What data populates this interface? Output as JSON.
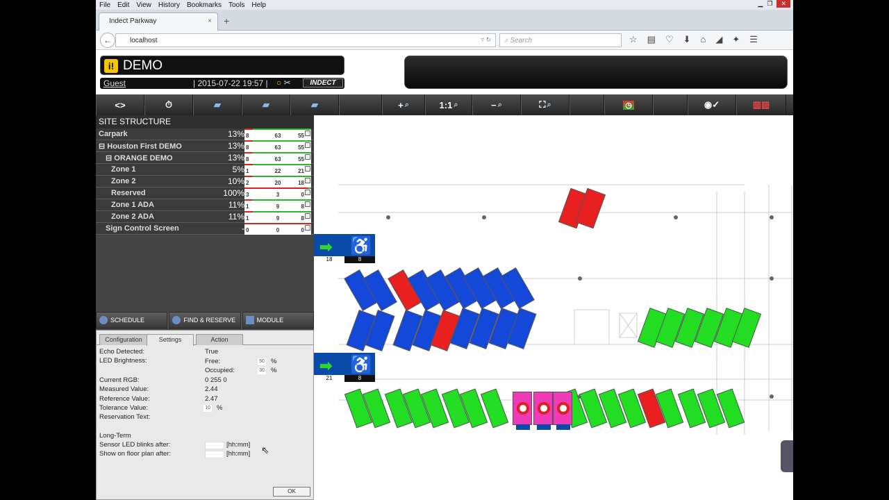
{
  "browser": {
    "menu": [
      "File",
      "Edit",
      "View",
      "History",
      "Bookmarks",
      "Tools",
      "Help"
    ],
    "tab_title": "Indect Parkway",
    "url": "localhost",
    "search_placeholder": "Search"
  },
  "app": {
    "title": "DEMO",
    "info_icon": "i!",
    "user": "Guest",
    "datetime": "| 2015-07-22 19:57 |",
    "brand": "INDECT"
  },
  "toolbar": {
    "nav_label": "<>",
    "zoom_in": "+",
    "zoom_reset": "1:1",
    "zoom_out": "−",
    "zoom_fit_icon": "fit-icon"
  },
  "site": {
    "title": "SITE STRUCTURE",
    "rows": [
      {
        "name": "Carpark",
        "pct": "13%",
        "a": "8",
        "b": "63",
        "c": "55"
      },
      {
        "name": "⊟ Houston First DEMO",
        "pct": "13%",
        "a": "8",
        "b": "63",
        "c": "55"
      },
      {
        "name": "⊟ ORANGE DEMO",
        "pct": "13%",
        "a": "8",
        "b": "63",
        "c": "55"
      },
      {
        "name": "Zone 1",
        "pct": "5%",
        "a": "1",
        "b": "22",
        "c": "21"
      },
      {
        "name": "Zone 2",
        "pct": "10%",
        "a": "2",
        "b": "20",
        "c": "18"
      },
      {
        "name": "Reserved",
        "pct": "100%",
        "a": "3",
        "b": "3",
        "c": "0"
      },
      {
        "name": "Zone 1 ADA",
        "pct": "11%",
        "a": "1",
        "b": "9",
        "c": "8"
      },
      {
        "name": "Zone 2 ADA",
        "pct": "11%",
        "a": "1",
        "b": "9",
        "c": "8"
      },
      {
        "name": "Sign Control Screen",
        "pct": "-",
        "a": "0",
        "b": "0",
        "c": "0"
      }
    ]
  },
  "modules": [
    "SCHEDULE",
    "FIND & RESERVE",
    "MODULE"
  ],
  "settings": {
    "tabs": [
      "Configuration",
      "Settings",
      "Action"
    ],
    "echo_label": "Echo Detected:",
    "echo_value": "True",
    "led_label": "LED Brightness:",
    "free_label": "Free:",
    "free_value": "50",
    "occupied_label": "Occupied:",
    "occupied_value": "30",
    "pct": "%",
    "rgb_label": "Current RGB:",
    "rgb_value": "0 255 0",
    "measured_label": "Measured Value:",
    "measured_value": "2.44",
    "reference_label": "Reference Value:",
    "reference_value": "2.47",
    "tolerance_label": "Tolerance Value:",
    "tolerance_value": "10",
    "reservation_label": "Reservation Text:",
    "longterm_label": "Long-Term",
    "blink_label": "Sensor LED blinks after:",
    "show_label": "Show on floor plan after:",
    "hhmm": "[hh:mm]",
    "ok": "OK"
  },
  "map": {
    "sign1": {
      "left": "18",
      "right": "8"
    },
    "sign2": {
      "left": "21",
      "right": "8"
    },
    "colors": {
      "free": "#22dd22",
      "occupied": "#e82020",
      "ada": "#1448d8",
      "reserved": "#f03ab8"
    }
  }
}
